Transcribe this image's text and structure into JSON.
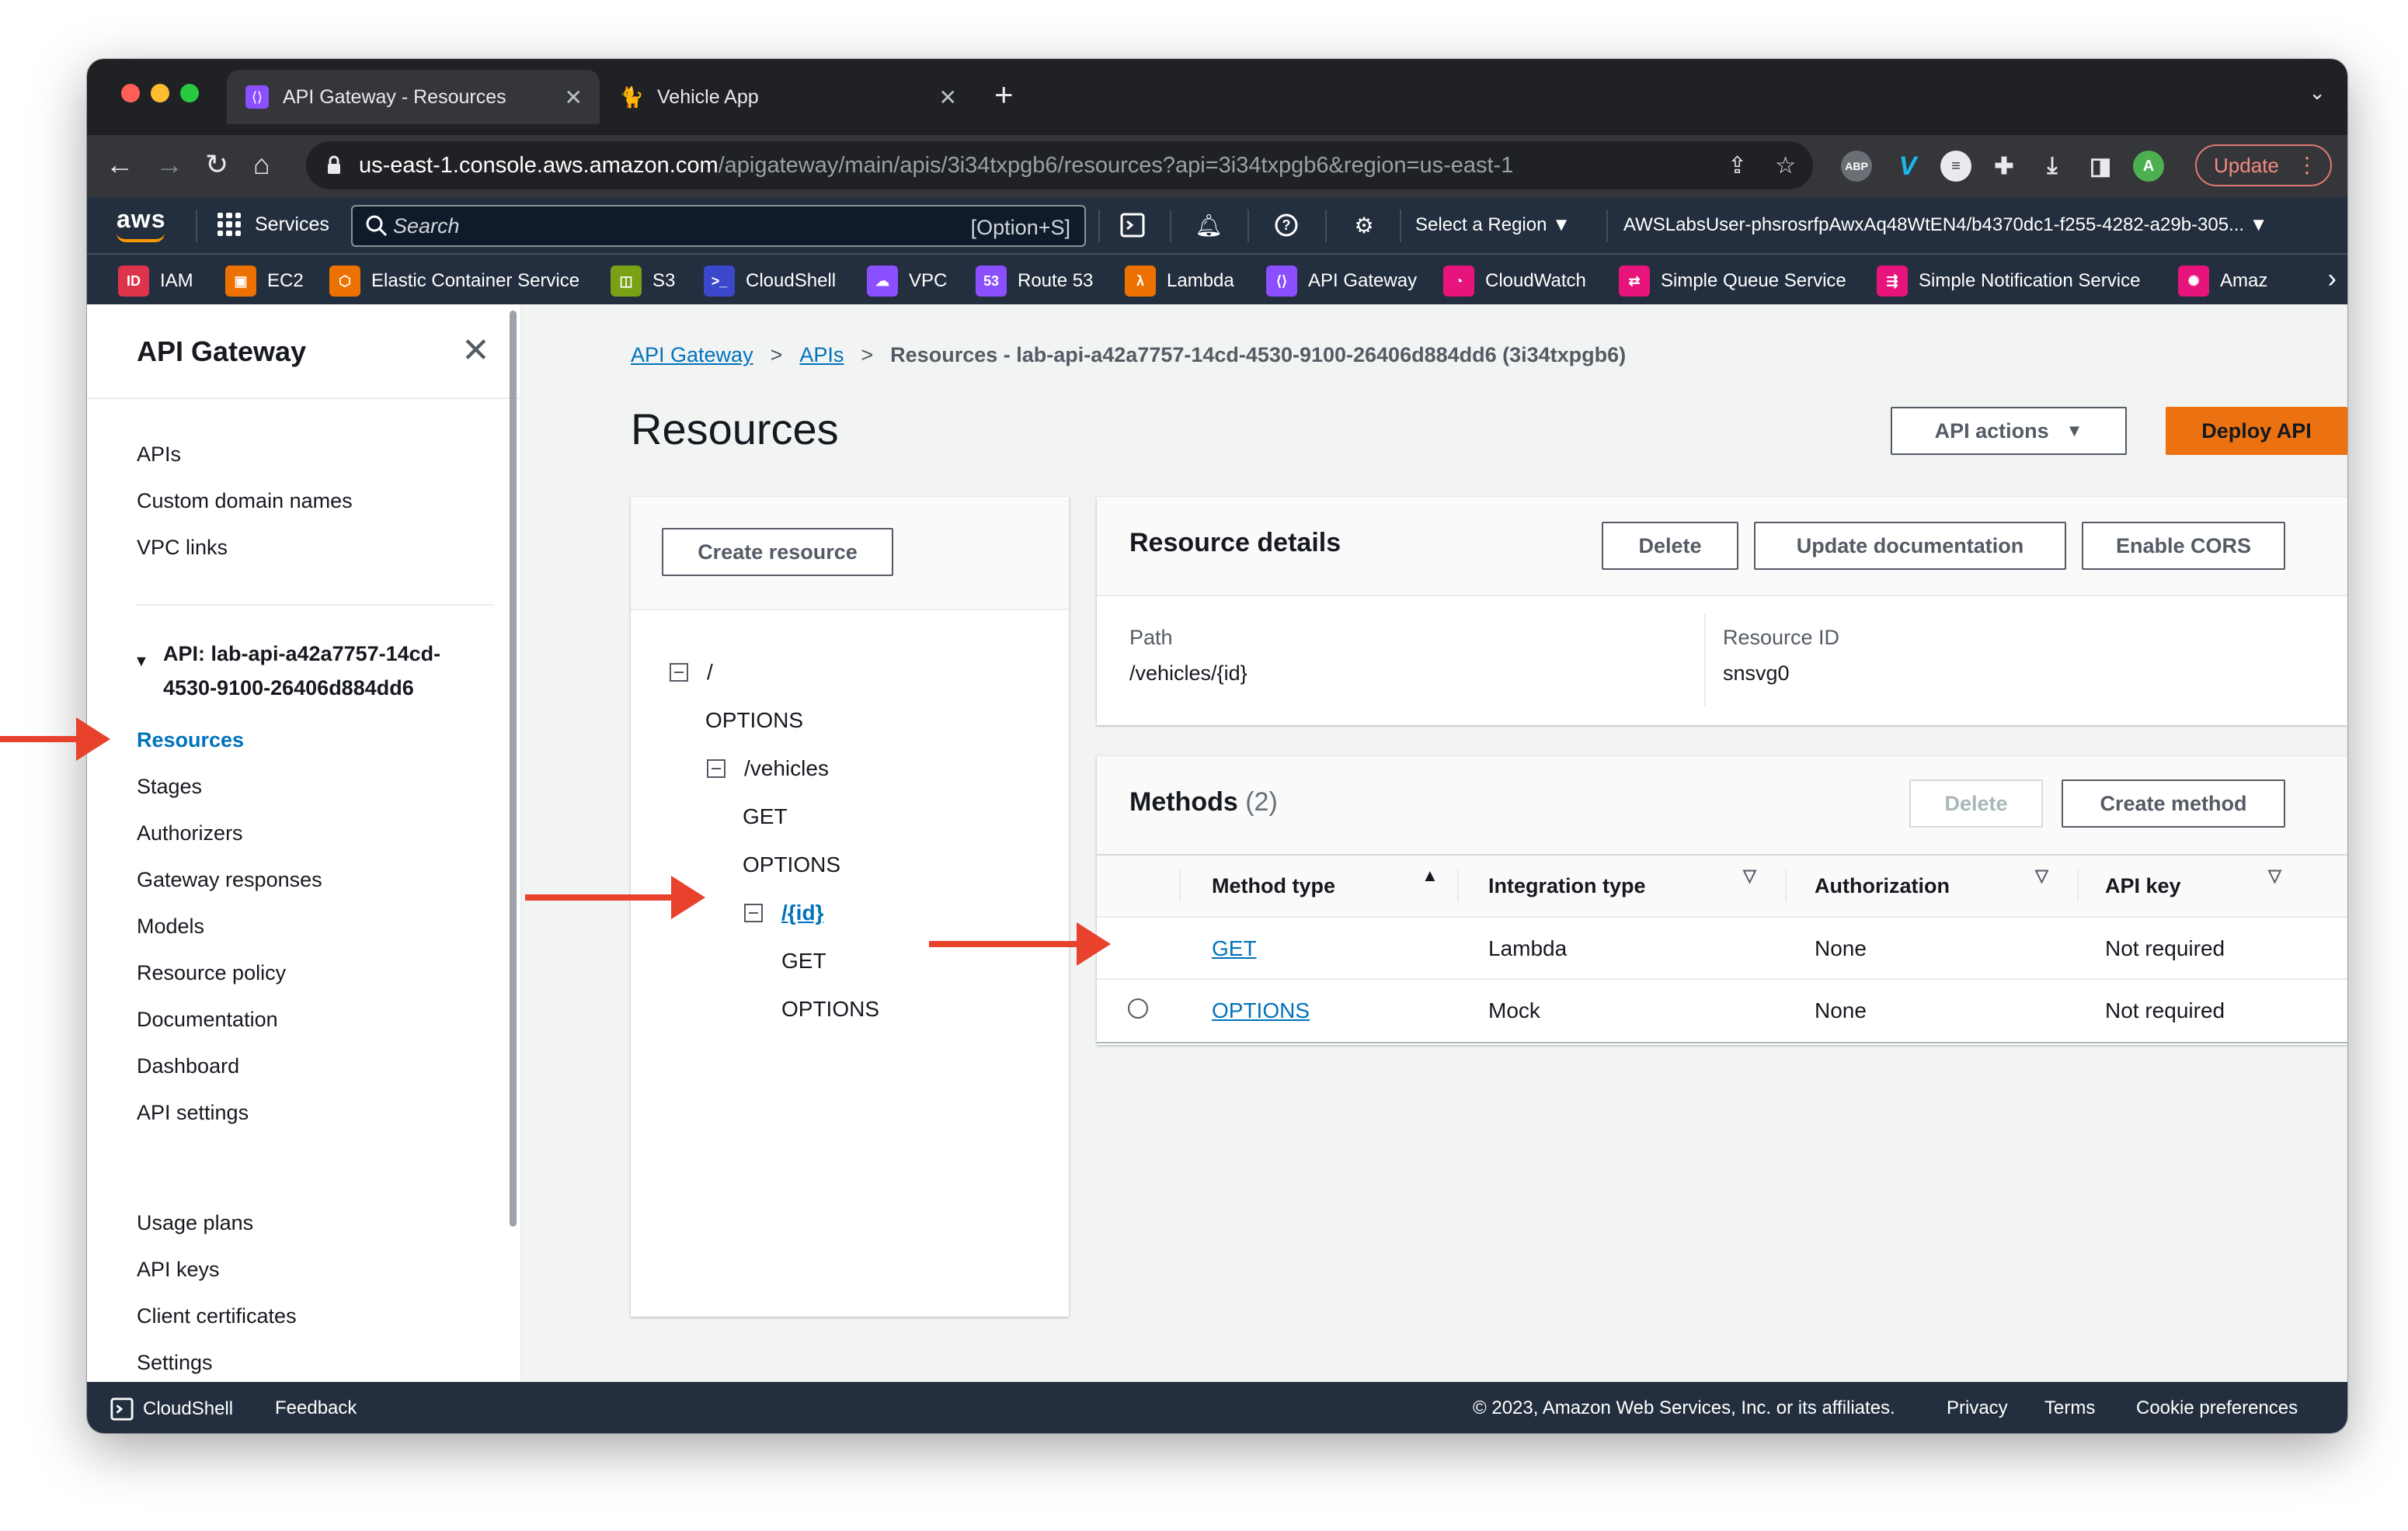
{
  "browser": {
    "tabs": [
      {
        "title": "API Gateway - Resources",
        "active": true
      },
      {
        "title": "Vehicle App",
        "active": false
      }
    ],
    "url_host": "us-east-1.console.aws.amazon.com",
    "url_path": "/apigateway/main/apis/3i34txpgb6/resources?api=3i34txpgb6&region=us-east-1",
    "update_label": "Update",
    "profile_initial": "A"
  },
  "aws_nav": {
    "logo": "aws",
    "services_label": "Services",
    "search_placeholder": "Search",
    "search_shortcut": "[Option+S]",
    "region_label": "Select a Region ▼",
    "account_label": "AWSLabsUser-phsrosrfpAwxAq48WtEN4/b4370dc1-f255-4282-a29b-305... ▼"
  },
  "favorites": [
    {
      "label": "IAM",
      "color": "#dd344c"
    },
    {
      "label": "EC2",
      "color": "#ed7100"
    },
    {
      "label": "Elastic Container Service",
      "color": "#ed7100"
    },
    {
      "label": "S3",
      "color": "#7aa116"
    },
    {
      "label": "CloudShell",
      "color": "#3b48cc"
    },
    {
      "label": "VPC",
      "color": "#8c4fff"
    },
    {
      "label": "Route 53",
      "color": "#8c4fff"
    },
    {
      "label": "Lambda",
      "color": "#ed7100"
    },
    {
      "label": "API Gateway",
      "color": "#8c4fff"
    },
    {
      "label": "CloudWatch",
      "color": "#e7157b"
    },
    {
      "label": "Simple Queue Service",
      "color": "#e7157b"
    },
    {
      "label": "Simple Notification Service",
      "color": "#e7157b"
    },
    {
      "label": "Amaz",
      "color": "#e7157b"
    }
  ],
  "sidebar": {
    "title": "API Gateway",
    "top_items": [
      "APIs",
      "Custom domain names",
      "VPC links"
    ],
    "api_label": "API: lab-api-a42a7757-14cd-4530-9100-26406d884dd6",
    "api_items": [
      "Resources",
      "Stages",
      "Authorizers",
      "Gateway responses",
      "Models",
      "Resource policy",
      "Documentation",
      "Dashboard",
      "API settings"
    ],
    "bottom_items": [
      "Usage plans",
      "API keys",
      "Client certificates",
      "Settings"
    ]
  },
  "breadcrumb": {
    "items": [
      "API Gateway",
      "APIs"
    ],
    "current": "Resources - lab-api-a42a7757-14cd-4530-9100-26406d884dd6 (3i34txpgb6)"
  },
  "page": {
    "title": "Resources",
    "api_actions_label": "API actions",
    "deploy_label": "Deploy API"
  },
  "tree": {
    "create_resource_label": "Create resource",
    "nodes": [
      "/",
      "OPTIONS",
      "/vehicles",
      "GET",
      "OPTIONS",
      "/{id}",
      "GET",
      "OPTIONS"
    ]
  },
  "resource_details": {
    "title": "Resource details",
    "delete_label": "Delete",
    "update_doc_label": "Update documentation",
    "enable_cors_label": "Enable CORS",
    "path_label": "Path",
    "path_value": "/vehicles/{id}",
    "resource_id_label": "Resource ID",
    "resource_id_value": "snsvg0"
  },
  "methods": {
    "title": "Methods",
    "count": "(2)",
    "delete_label": "Delete",
    "create_label": "Create method",
    "columns": [
      "Method type",
      "Integration type",
      "Authorization",
      "API key"
    ],
    "rows": [
      {
        "method": "GET",
        "integration": "Lambda",
        "authorization": "None",
        "api_key": "Not required"
      },
      {
        "method": "OPTIONS",
        "integration": "Mock",
        "authorization": "None",
        "api_key": "Not required"
      }
    ]
  },
  "footer": {
    "cloudshell_label": "CloudShell",
    "feedback_label": "Feedback",
    "copyright": "© 2023, Amazon Web Services, Inc. or its affiliates.",
    "privacy_label": "Privacy",
    "terms_label": "Terms",
    "cookie_label": "Cookie preferences"
  },
  "colors": {
    "annotation_arrow": "#e8412c",
    "aws_orange": "#ec7211",
    "link_blue": "#0073bb"
  }
}
